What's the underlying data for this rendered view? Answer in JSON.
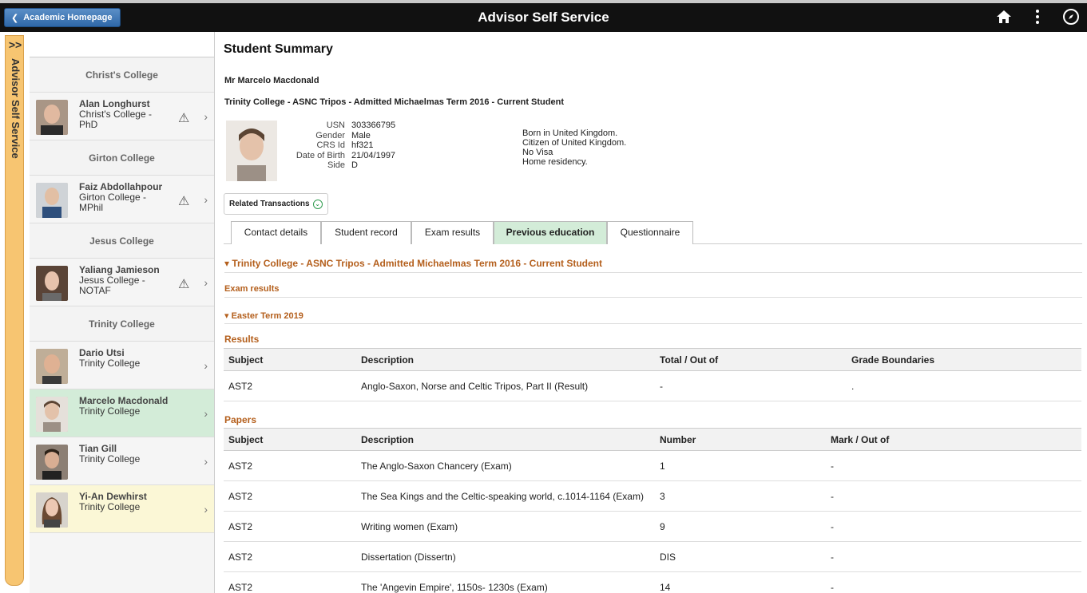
{
  "header": {
    "back_label": "Academic Homepage",
    "title": "Advisor Self Service",
    "icons": [
      "home-icon",
      "kebab-menu-icon",
      "navigation-compass-icon"
    ]
  },
  "sidetab": {
    "chevron": ">>",
    "label": "Advisor Self Service"
  },
  "student_list": {
    "colleges": [
      {
        "name": "Christ's College",
        "students": [
          {
            "name": "Alan Longhurst",
            "detail": "Christ's College - PhD",
            "warning": true
          }
        ]
      },
      {
        "name": "Girton College",
        "students": [
          {
            "name": "Faiz Abdollahpour",
            "detail": "Girton College - MPhil",
            "warning": true
          }
        ]
      },
      {
        "name": "Jesus College",
        "students": [
          {
            "name": "Yaliang Jamieson",
            "detail": "Jesus College - NOTAF",
            "warning": true
          }
        ]
      },
      {
        "name": "Trinity College",
        "students": [
          {
            "name": "Dario Utsi",
            "detail": "Trinity College",
            "warning": false
          },
          {
            "name": "Marcelo Macdonald",
            "detail": "Trinity College",
            "warning": false,
            "selected": true
          },
          {
            "name": "Tian Gill",
            "detail": "Trinity College",
            "warning": false
          },
          {
            "name": "Yi-An Dewhirst",
            "detail": "Trinity College",
            "warning": false
          }
        ]
      }
    ]
  },
  "main": {
    "page_title": "Student Summary",
    "student_name": "Mr Marcelo Macdonald",
    "program": "Trinity College - ASNC Tripos - Admitted Michaelmas Term 2016 - Current Student",
    "bio": [
      {
        "label": "USN",
        "value": "303366795"
      },
      {
        "label": "Gender",
        "value": "Male"
      },
      {
        "label": "CRS Id",
        "value": "hf321"
      },
      {
        "label": "Date of Birth",
        "value": "21/04/1997"
      },
      {
        "label": "Side",
        "value": "D"
      }
    ],
    "bio_right": [
      "Born in United Kingdom.",
      "Citizen of United Kingdom.",
      "No Visa",
      "Home residency."
    ],
    "related_transactions": "Related Transactions",
    "tabs": [
      "Contact details",
      "Student record",
      "Exam results",
      "Previous education",
      "Questionnaire"
    ],
    "active_tab": "Previous education",
    "section_program": "Trinity College - ASNC Tripos - Admitted Michaelmas Term 2016 - Current Student",
    "section_exam_results": "Exam results",
    "section_term": "Easter Term 2019",
    "results": {
      "title": "Results",
      "headers": [
        "Subject",
        "Description",
        "Total / Out of",
        "Grade Boundaries"
      ],
      "rows": [
        [
          "AST2",
          "Anglo-Saxon, Norse and Celtic Tripos, Part II (Result)",
          "-",
          "."
        ]
      ]
    },
    "papers": {
      "title": "Papers",
      "headers": [
        "Subject",
        "Description",
        "Number",
        "Mark / Out of"
      ],
      "rows": [
        [
          "AST2",
          "The Anglo-Saxon Chancery (Exam)",
          "1",
          "-"
        ],
        [
          "AST2",
          "The Sea Kings and the Celtic-speaking world, c.1014-1164 (Exam)",
          "3",
          "-"
        ],
        [
          "AST2",
          "Writing women (Exam)",
          "9",
          "-"
        ],
        [
          "AST2",
          "Dissertation (Dissertn)",
          "DIS",
          "-"
        ],
        [
          "AST2",
          "The 'Angevin Empire', 1150s- 1230s (Exam)",
          "14",
          "-"
        ]
      ]
    }
  }
}
